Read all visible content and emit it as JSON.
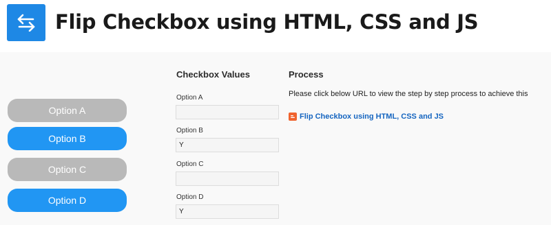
{
  "page": {
    "title": "Flip Checkbox using HTML, CSS and JS"
  },
  "colors": {
    "accent": "#2196f3",
    "toggle_off": "#b9b9b9",
    "logo_bg": "#1e88e5",
    "link": "#1565c0"
  },
  "toggles": [
    {
      "label": "Option A",
      "checked": false
    },
    {
      "label": "Option B",
      "checked": true
    },
    {
      "label": "Option C",
      "checked": false
    },
    {
      "label": "Option D",
      "checked": true
    }
  ],
  "values_section": {
    "heading": "Checkbox Values",
    "fields": [
      {
        "label": "Option A",
        "value": ""
      },
      {
        "label": "Option B",
        "value": "Y"
      },
      {
        "label": "Option C",
        "value": ""
      },
      {
        "label": "Option D",
        "value": "Y"
      }
    ]
  },
  "process_section": {
    "heading": "Process",
    "description": "Please click below URL to view the step by step process to achieve this",
    "link_icon": "blogger-icon",
    "link_text": "Flip Checkbox using HTML, CSS and JS"
  }
}
